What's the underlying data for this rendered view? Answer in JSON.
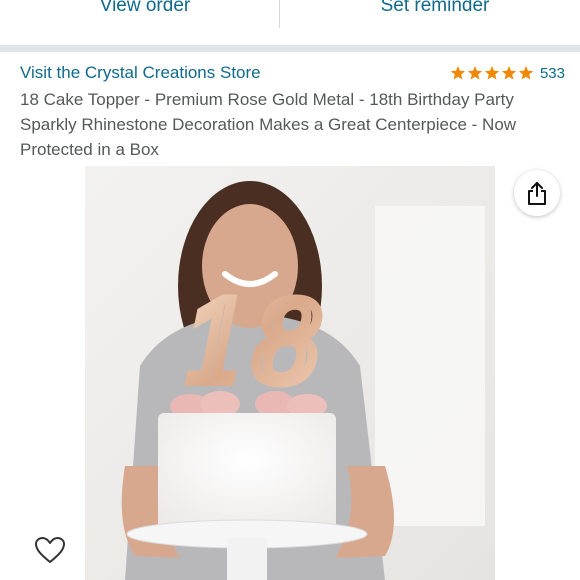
{
  "actions": {
    "view_order": "View order",
    "set_reminder": "Set reminder"
  },
  "store": {
    "link_text": "Visit the Crystal Creations Store"
  },
  "rating": {
    "stars": 5,
    "count": "533",
    "star_color": "#f08804"
  },
  "product": {
    "title": "18 Cake Topper - Premium Rose Gold Metal - 18th Birthday Party Sparkly Rhinestone Decoration Makes a Great Centerpiece - Now Protected in a Box",
    "image_topper_text": "18"
  },
  "icons": {
    "share": "share-icon",
    "favorite": "heart-icon"
  },
  "colors": {
    "link": "#0f6a8b",
    "title_text": "#565959",
    "separator": "#dfe5e4"
  }
}
